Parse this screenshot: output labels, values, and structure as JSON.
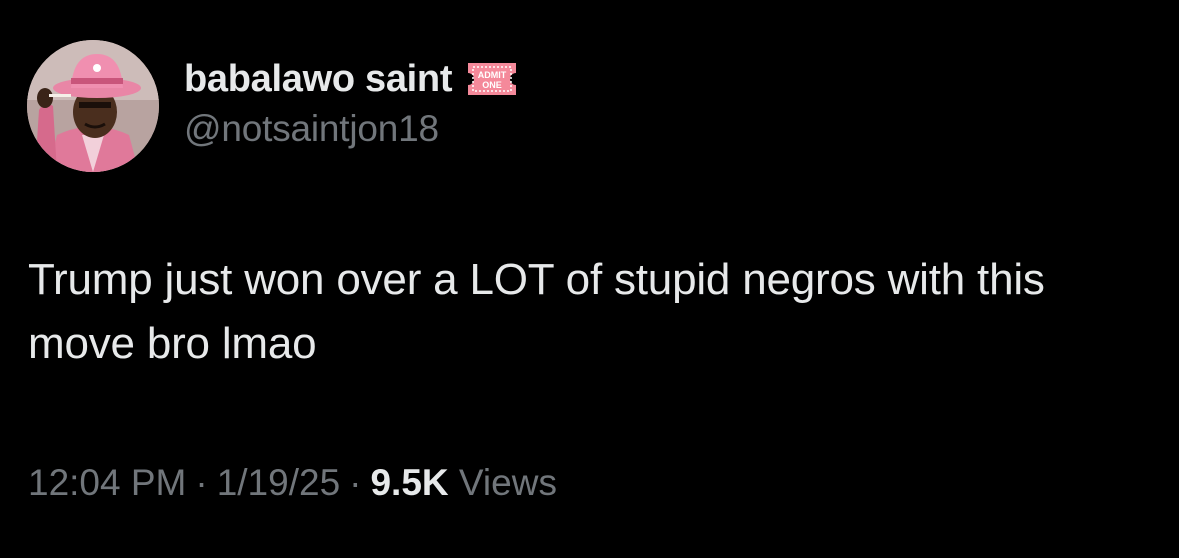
{
  "author": {
    "display_name": "babalawo saint",
    "handle": "@notsaintjon18",
    "avatar_icon": "avatar-pink-hat-icon",
    "badge_icon": "admit-one-ticket-icon",
    "badge_text_line1": "ADMIT",
    "badge_text_line2": "ONE"
  },
  "tweet": {
    "text": "Trump just won over a LOT of stupid negros with this move bro lmao"
  },
  "meta": {
    "time": "12:04 PM",
    "separator": "·",
    "date": "1/19/25",
    "views_count": "9.5K",
    "views_label": "Views"
  },
  "colors": {
    "background": "#000000",
    "primary_text": "#e7e9ea",
    "secondary_text": "#71767b",
    "badge_pink": "#f4899a"
  }
}
